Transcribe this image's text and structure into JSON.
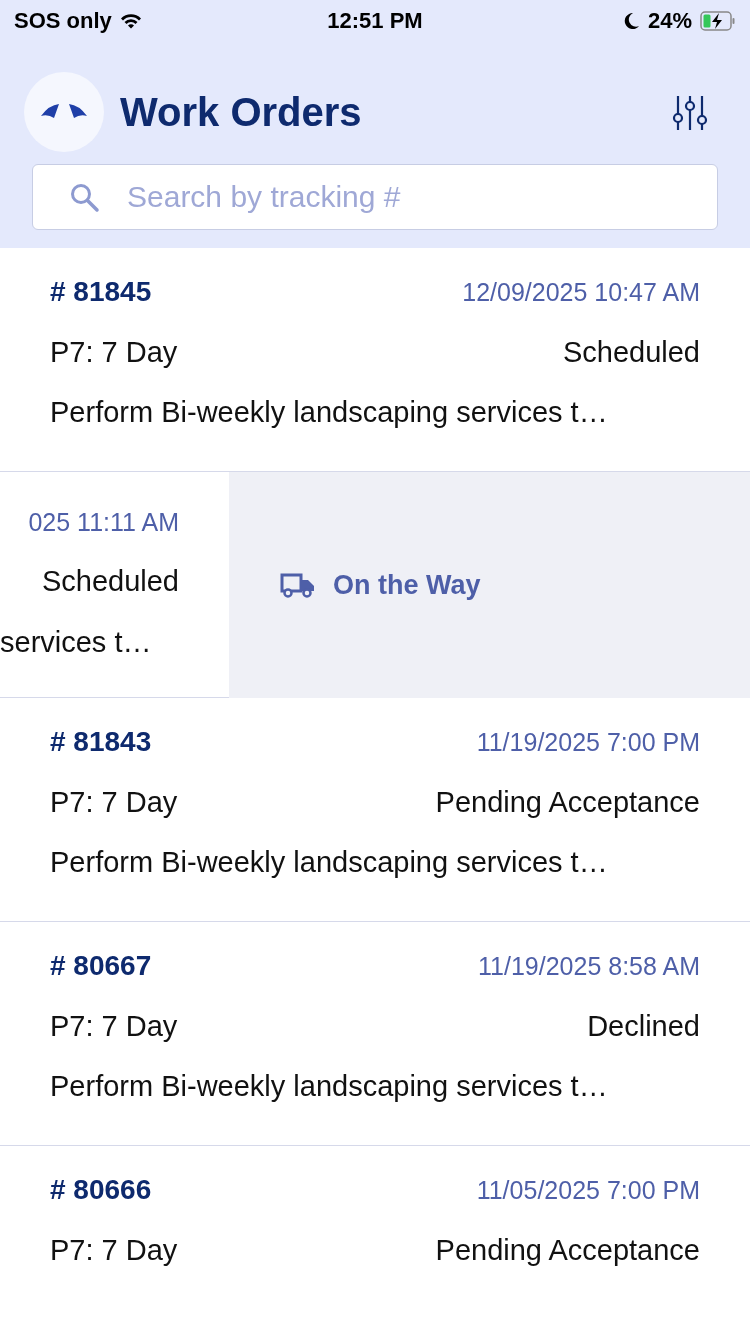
{
  "status_bar": {
    "carrier": "SOS only",
    "time": "12:51 PM",
    "battery": "24%"
  },
  "header": {
    "title": "Work Orders"
  },
  "search": {
    "placeholder": "Search by tracking #"
  },
  "orders": [
    {
      "kind": "normal",
      "number": "# 81845",
      "date": "12/09/2025 10:47 AM",
      "priority": "P7: 7 Day",
      "status": "Scheduled",
      "description": "Perform Bi-weekly landscaping services t…"
    },
    {
      "kind": "swiped",
      "date": "025 11:11 AM",
      "status": "Scheduled",
      "description": "services t…",
      "action": "On the Way"
    },
    {
      "kind": "normal",
      "number": "# 81843",
      "date": "11/19/2025 7:00 PM",
      "priority": "P7: 7 Day",
      "status": "Pending Acceptance",
      "description": "Perform Bi-weekly landscaping services t…"
    },
    {
      "kind": "normal",
      "number": "# 80667",
      "date": "11/19/2025 8:58 AM",
      "priority": "P7: 7 Day",
      "status": "Declined",
      "description": "Perform Bi-weekly landscaping services t…"
    },
    {
      "kind": "normal",
      "number": "# 80666",
      "date": "11/05/2025 7:00 PM",
      "priority": "P7: 7 Day",
      "status": "Pending Acceptance"
    }
  ]
}
